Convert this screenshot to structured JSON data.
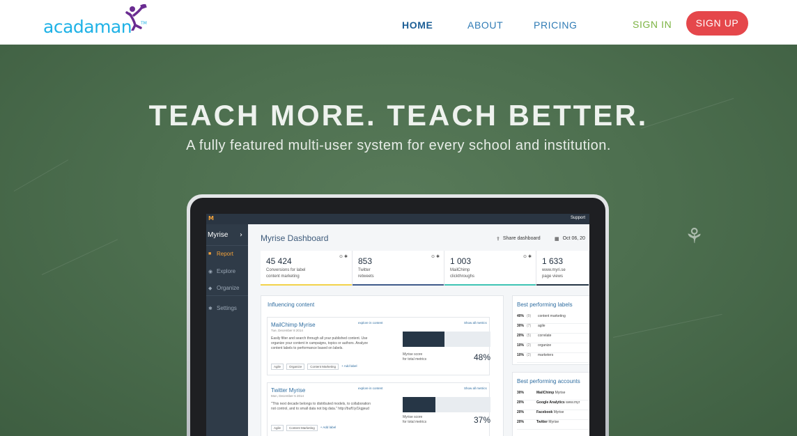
{
  "nav": {
    "logo_text": "acadaman",
    "logo_tm": "TM",
    "links": [
      {
        "label": "HOME",
        "active": true
      },
      {
        "label": "ABOUT",
        "active": false
      },
      {
        "label": "PRICING",
        "active": false
      }
    ],
    "sign_in": "SIGN IN",
    "sign_up": "SIGN UP"
  },
  "hero": {
    "headline": "TEACH MORE. TEACH BETTER.",
    "subline": "A fully featured multi-user system for every school and institution."
  },
  "dashboard": {
    "support": "Support",
    "brand": "Myrise",
    "menu": [
      {
        "label": "Report",
        "icon": "report-icon",
        "active": true
      },
      {
        "label": "Explore",
        "icon": "explore-icon",
        "active": false
      },
      {
        "label": "Organize",
        "icon": "tag-icon",
        "active": false
      },
      {
        "label": "Settings",
        "icon": "gear-icon",
        "active": false
      }
    ],
    "title": "Myrise Dashboard",
    "share": "Share dashboard",
    "date": "Oct 06, 20",
    "kpis": [
      {
        "value": "45 424",
        "label1": "Conversions for label",
        "label2": "content marketing",
        "color": "#f2d24a"
      },
      {
        "value": "853",
        "label1": "Twitter",
        "label2": "retweets",
        "color": "#3f5a8a"
      },
      {
        "value": "1 003",
        "label1": "MailChimp",
        "label2": "clickthroughs",
        "color": "#3ec4b4"
      },
      {
        "value": "1 633",
        "label1": "www.myri.se",
        "label2": "page views",
        "color": "#263646"
      }
    ],
    "influencing": {
      "title": "Influencing content",
      "cards": [
        {
          "title": "MailChimp Myrise",
          "date": "Tue, December 8 2014",
          "explore": "explore in content",
          "show": "Show all metrics",
          "body": [
            "Easily filter and search through all your published content.",
            "Use organize your content in campaigns, topics or authors.",
            "Analyze content labels to performance based on labels."
          ],
          "tags": [
            "Agile",
            "Organize",
            "Content Marketing"
          ],
          "add_label": "+ Add label",
          "score_label1": "Myrise score",
          "score_label2": "for total metrics",
          "score": "48%",
          "score_fraction": 0.48
        },
        {
          "title": "Twitter Myrise",
          "date": "Mon, December 5 2014",
          "explore": "explore in content",
          "show": "Show all metrics",
          "body": [
            "\"This next decade belongs to distributed models, to",
            "collaboration not control, and to small data not big",
            "data.\" http://buff.ly/1kgjeud"
          ],
          "tags": [
            "Agile",
            "Content Marketing"
          ],
          "add_label": "+ Add label",
          "score_label1": "Myrise score",
          "score_label2": "for total metrics",
          "score": "37%",
          "score_fraction": 0.37
        }
      ]
    },
    "best_labels": {
      "title": "Best performing labels",
      "rows": [
        {
          "pct": "40%",
          "n": "(9)",
          "label": "content marketing"
        },
        {
          "pct": "30%",
          "n": "(7)",
          "label": "agile"
        },
        {
          "pct": "20%",
          "n": "(5)",
          "label": "correlate"
        },
        {
          "pct": "10%",
          "n": "(2)",
          "label": "organize"
        },
        {
          "pct": "10%",
          "n": "(2)",
          "label": "marketers"
        }
      ]
    },
    "best_accounts": {
      "title": "Best performing accounts",
      "rows": [
        {
          "pct": "30%",
          "name": "MailChimp",
          "rest": "Myrise"
        },
        {
          "pct": "20%",
          "name": "Google Analytics",
          "rest": "www.myr"
        },
        {
          "pct": "20%",
          "name": "Facebook",
          "rest": "Myrise"
        },
        {
          "pct": "20%",
          "name": "Twitter",
          "rest": "Myrise"
        }
      ]
    }
  }
}
